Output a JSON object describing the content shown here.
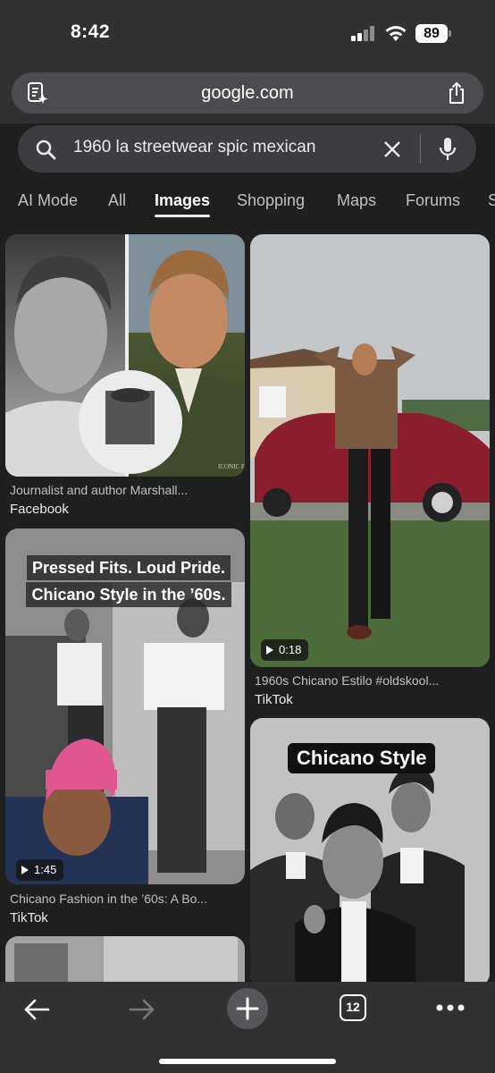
{
  "status_bar": {
    "time": "8:42",
    "battery": "89"
  },
  "browser": {
    "url": "google.com"
  },
  "search": {
    "query": "1960 la streetwear spic mexican"
  },
  "tabs": [
    {
      "label": "AI Mode"
    },
    {
      "label": "All"
    },
    {
      "label": "Images",
      "active": true
    },
    {
      "label": "Shopping"
    },
    {
      "label": "Maps"
    },
    {
      "label": "Forums"
    },
    {
      "label": "S"
    }
  ],
  "results": [
    {
      "caption": "Journalist and author Marshall...",
      "source": "Facebook",
      "watermark": "ICONIC FRAME"
    },
    {
      "caption": "1960s Chicano Estilo #oldskool...",
      "source": "TikTok",
      "duration": "0:18"
    },
    {
      "caption": "Chicano Fashion in the ’60s: A Bo...",
      "source": "TikTok",
      "duration": "1:45",
      "overlay_line1": "Pressed Fits. Loud Pride.",
      "overlay_line2": "Chicano Style in the ’60s."
    },
    {
      "overlay": "Chicano Style"
    }
  ],
  "toolbar": {
    "tab_count": "12"
  },
  "colors": {
    "background": "#1f1f1f",
    "chrome": "#2f3133",
    "pill": "#4a4c4f",
    "accent": "#e8eaed"
  },
  "icons": [
    "page-summary-icon",
    "share-icon",
    "search-icon",
    "clear-icon",
    "mic-icon",
    "back-arrow-icon",
    "forward-arrow-icon",
    "new-tab-plus-icon",
    "tabs-icon",
    "more-icon"
  ]
}
